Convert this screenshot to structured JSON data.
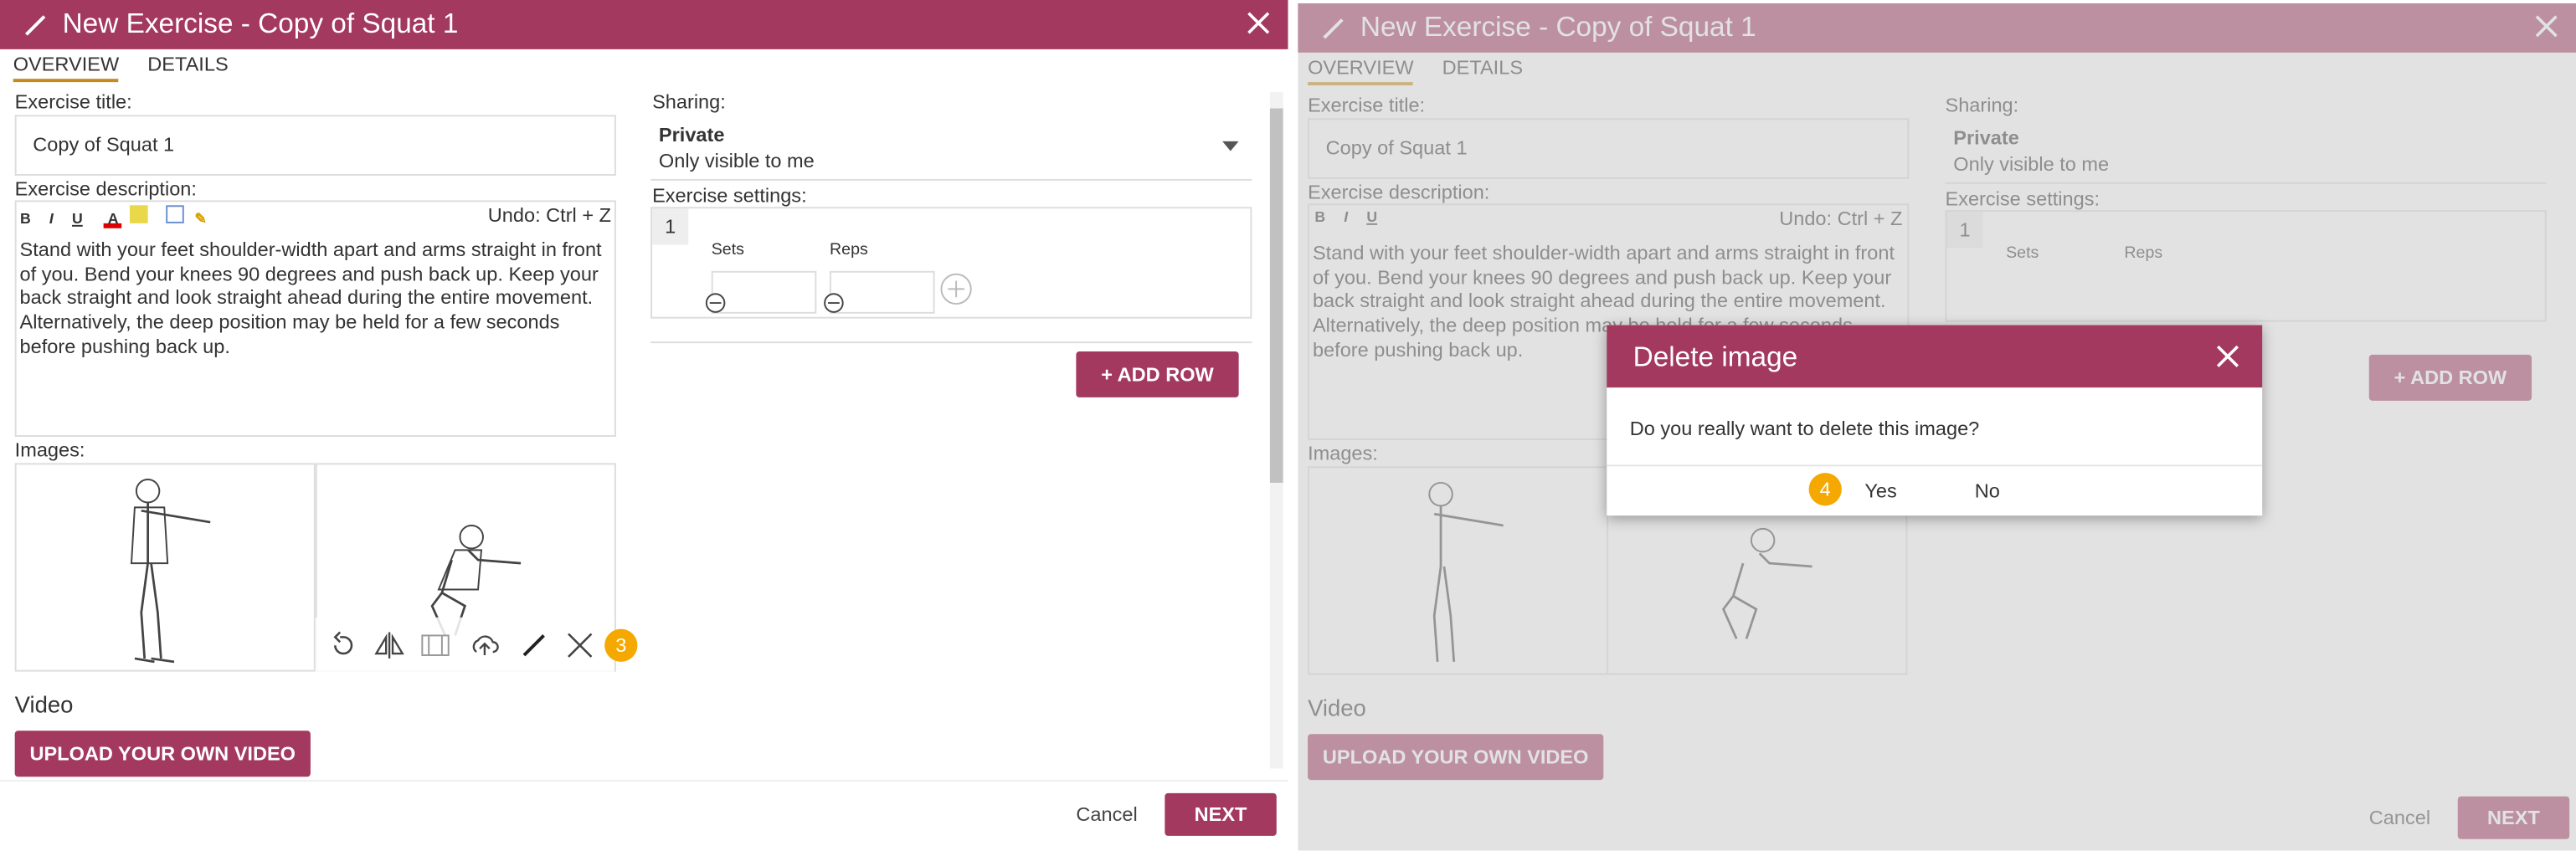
{
  "dialog_title": "New Exercise - Copy of Squat 1",
  "tabs": [
    "OVERVIEW",
    "DETAILS"
  ],
  "labels": {
    "exercise_title": "Exercise title:",
    "exercise_description": "Exercise description:",
    "images": "Images:",
    "video": "Video",
    "sharing": "Sharing:",
    "exercise_settings": "Exercise settings:"
  },
  "exercise_title_value": "Copy of Squat 1",
  "editor": {
    "bold": "B",
    "italic": "I",
    "underline": "U",
    "undo_hint": "Undo: Ctrl + Z"
  },
  "description_text": "Stand with your feet shoulder-width apart and arms straight in front of you. Bend your knees 90 degrees and push back up. Keep your back straight and look straight ahead during the entire movement. Alternatively, the deep position may be held for a few seconds before pushing back up.",
  "sharing": {
    "title": "Private",
    "subtitle": "Only visible to me"
  },
  "settings": {
    "row_number": "1",
    "col_sets": "Sets",
    "col_reps": "Reps"
  },
  "buttons": {
    "add_row": "+ ADD ROW",
    "upload_video": "UPLOAD YOUR OWN VIDEO",
    "cancel": "Cancel",
    "next": "NEXT"
  },
  "step_badges": {
    "left": "3",
    "right": "4"
  },
  "delete_dialog": {
    "title": "Delete image",
    "message": "Do you really want to delete this image?",
    "yes": "Yes",
    "no": "No"
  },
  "colors": {
    "brand": "#a3395f",
    "badge": "#f5a800",
    "tab_underline": "#c58a1a"
  }
}
